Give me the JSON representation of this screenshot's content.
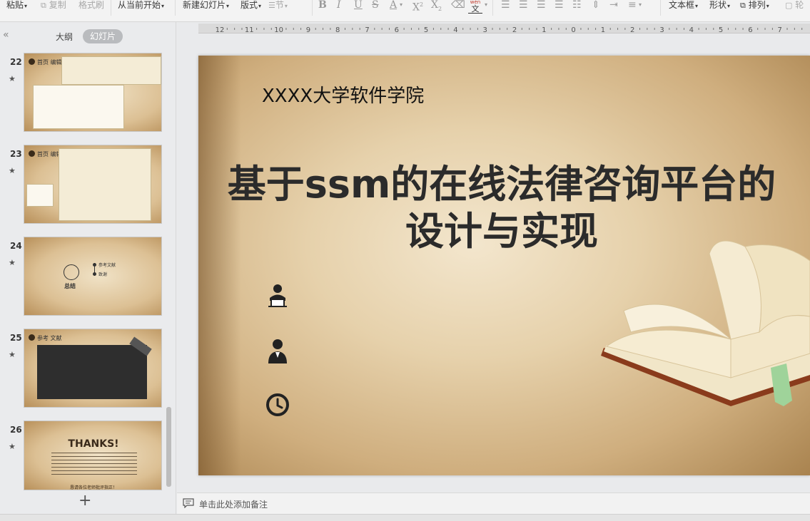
{
  "toolbar": {
    "paste": "粘贴",
    "copy": "复制",
    "format_painter": "格式刷",
    "from_current": "从当前开始",
    "new_slide": "新建幻灯片",
    "layout": "版式",
    "section": "节",
    "text_box": "文本框",
    "shape": "形状",
    "arrange": "排列",
    "outline_partial": "轮",
    "wen_glyph": "wén",
    "wen_char": "文"
  },
  "ruler": {
    "ticks": [
      "12",
      "11",
      "10",
      "9",
      "8",
      "7",
      "6",
      "5",
      "4",
      "3",
      "2",
      "1",
      "0",
      "1",
      "2",
      "3",
      "4",
      "5",
      "6",
      "7"
    ]
  },
  "sidebar": {
    "tab_outline": "大纲",
    "tab_slides": "幻灯片",
    "slides": [
      {
        "number": "22",
        "title": "首页 编辑"
      },
      {
        "number": "23",
        "title": "首页 编辑"
      },
      {
        "number": "24",
        "title": "总结",
        "bullets": [
          "参考文献",
          "致谢"
        ]
      },
      {
        "number": "25",
        "title": "参考 文献"
      },
      {
        "number": "26",
        "title": "THANKS!",
        "footer": "恳请各位老师批评指正！"
      }
    ]
  },
  "slide": {
    "school": "XXXX大学软件学院",
    "title_line1": "基于ssm的在线法律咨询平台的",
    "title_line2": "设计与实现"
  },
  "notes": {
    "placeholder": "单击此处添加备注"
  },
  "colors": {
    "accent_gray": "#b9bbbe",
    "slide_dark": "#2b2b2b"
  }
}
